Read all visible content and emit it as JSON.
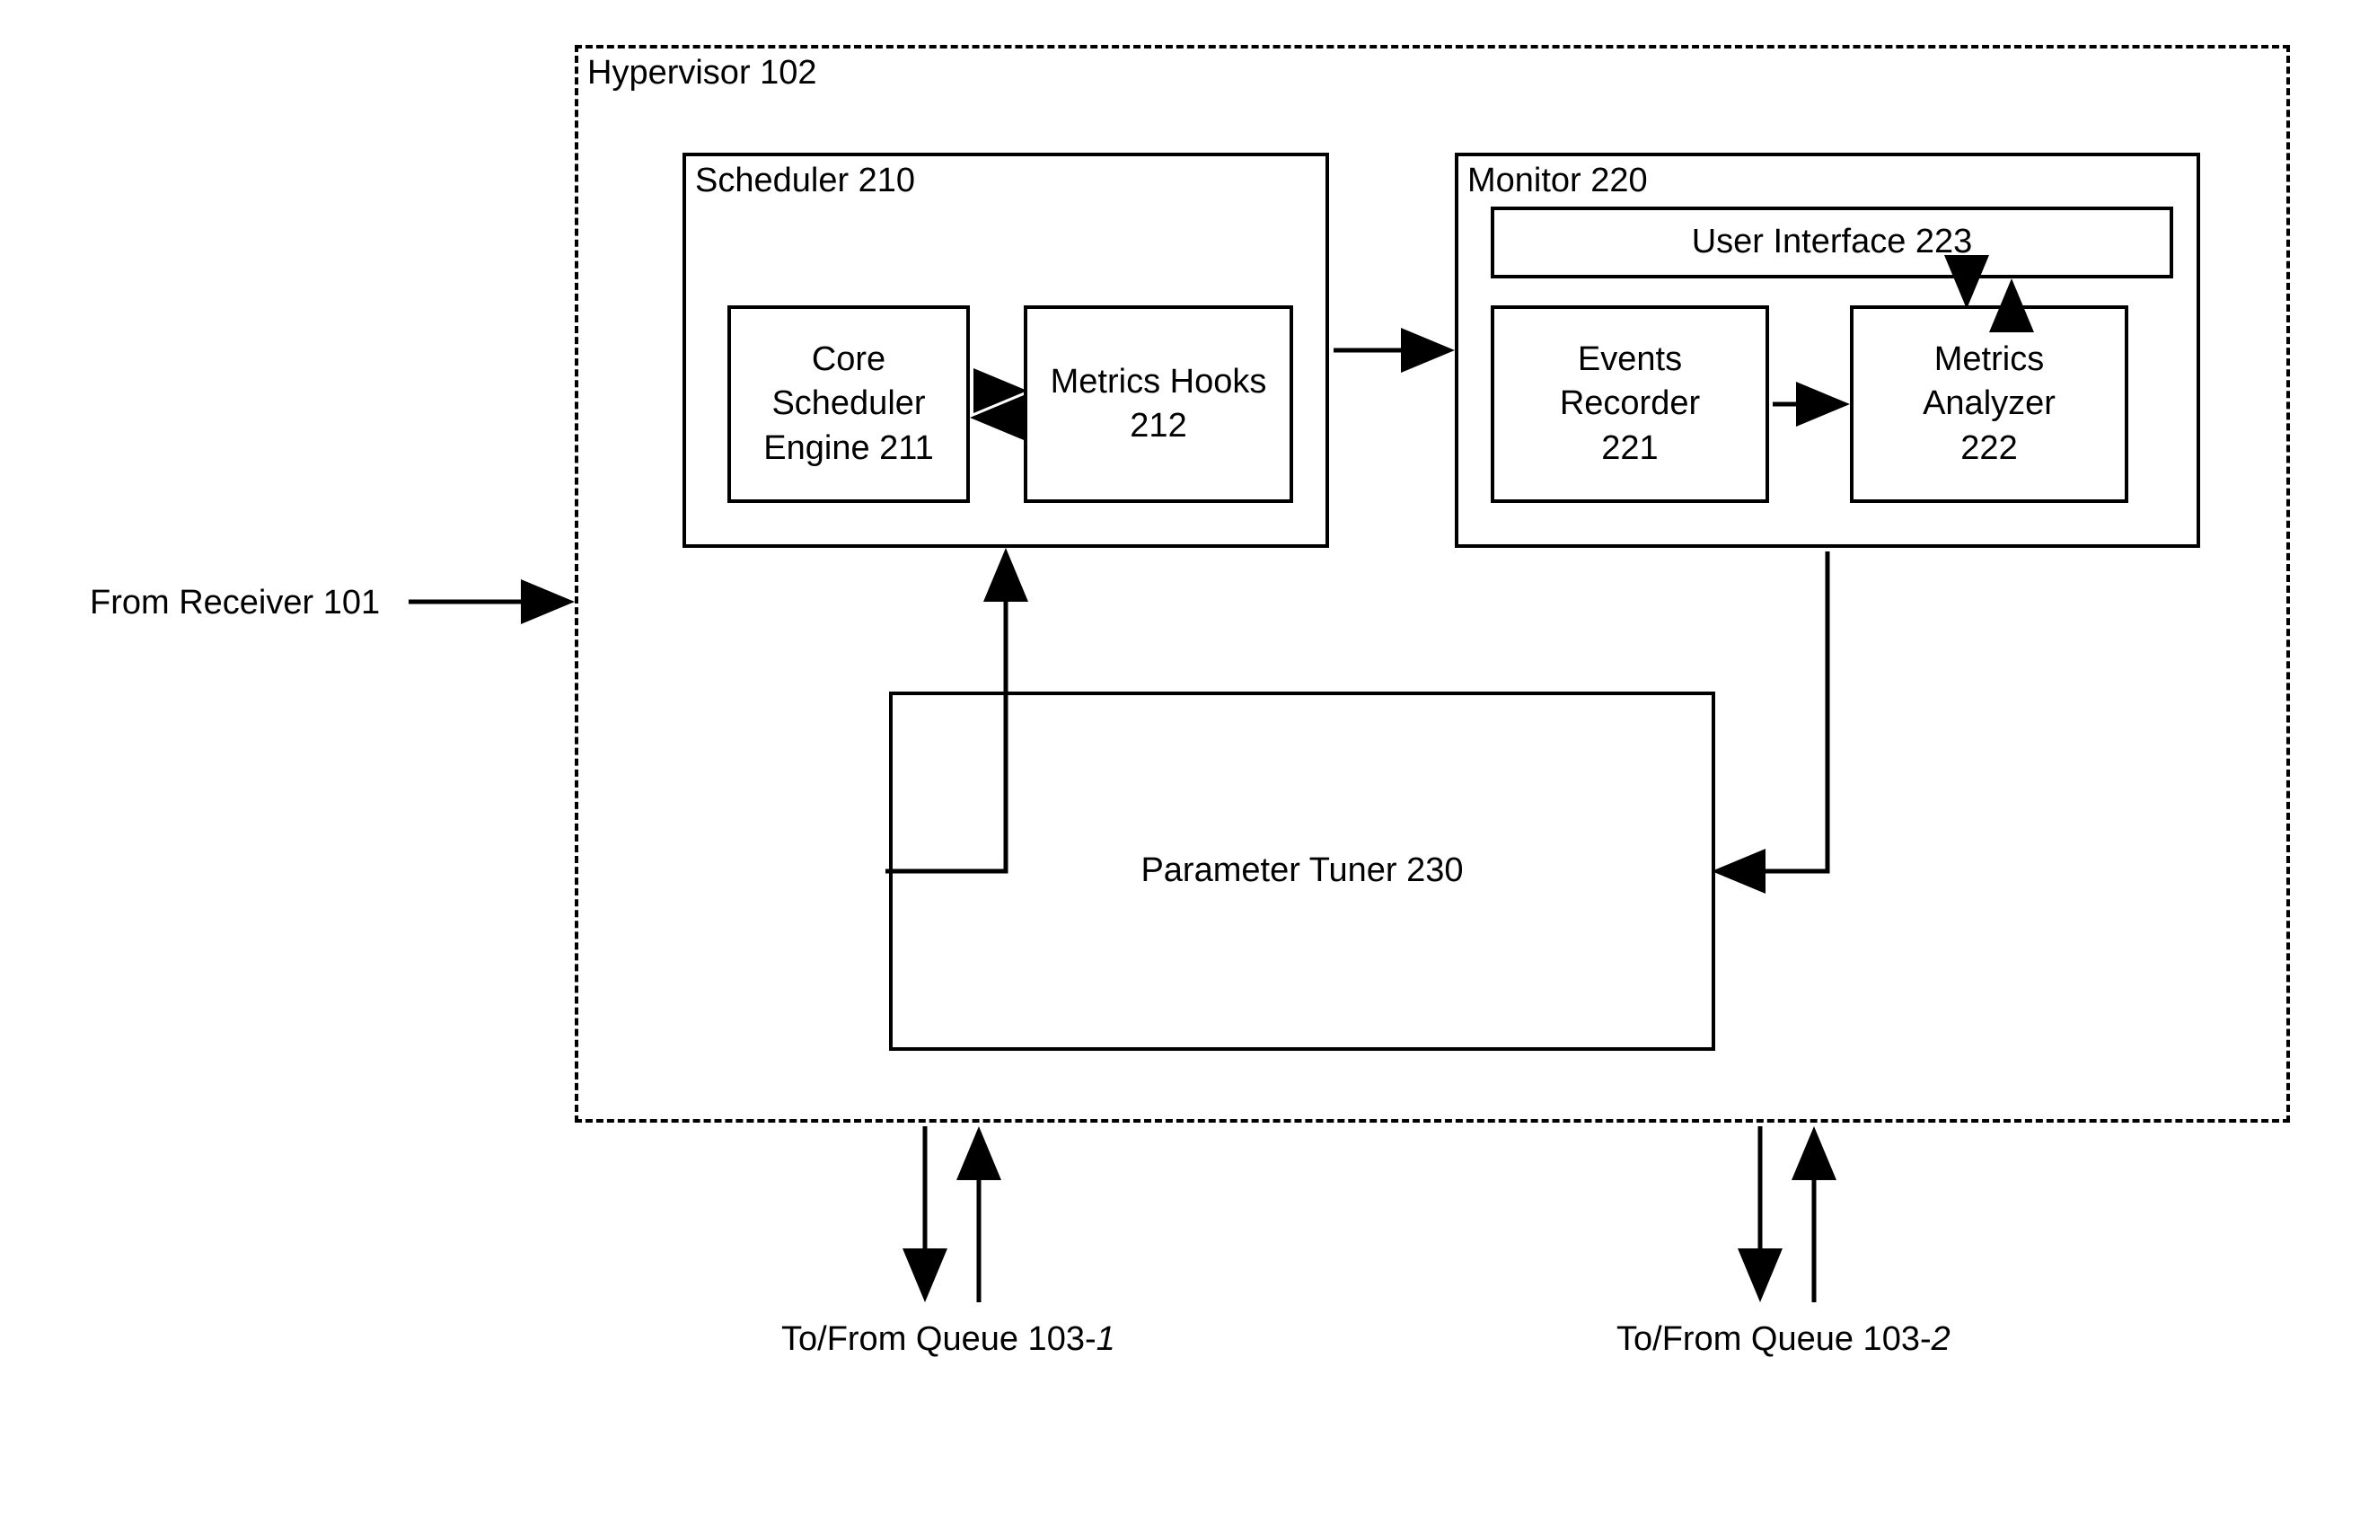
{
  "external": {
    "from_receiver": "From Receiver 101",
    "queue1": "To/From Queue 103-",
    "queue1_suffix": "1",
    "queue2": "To/From Queue 103-",
    "queue2_suffix": "2"
  },
  "hypervisor": {
    "title": "Hypervisor 102",
    "scheduler": {
      "title": "Scheduler 210",
      "core_engine": "Core\nScheduler\nEngine 211",
      "metrics_hooks": "Metrics Hooks\n212"
    },
    "monitor": {
      "title": "Monitor 220",
      "user_interface": "User Interface 223",
      "events_recorder": "Events\nRecorder\n221",
      "metrics_analyzer": "Metrics\nAnalyzer\n222"
    },
    "parameter_tuner": "Parameter Tuner 230"
  }
}
